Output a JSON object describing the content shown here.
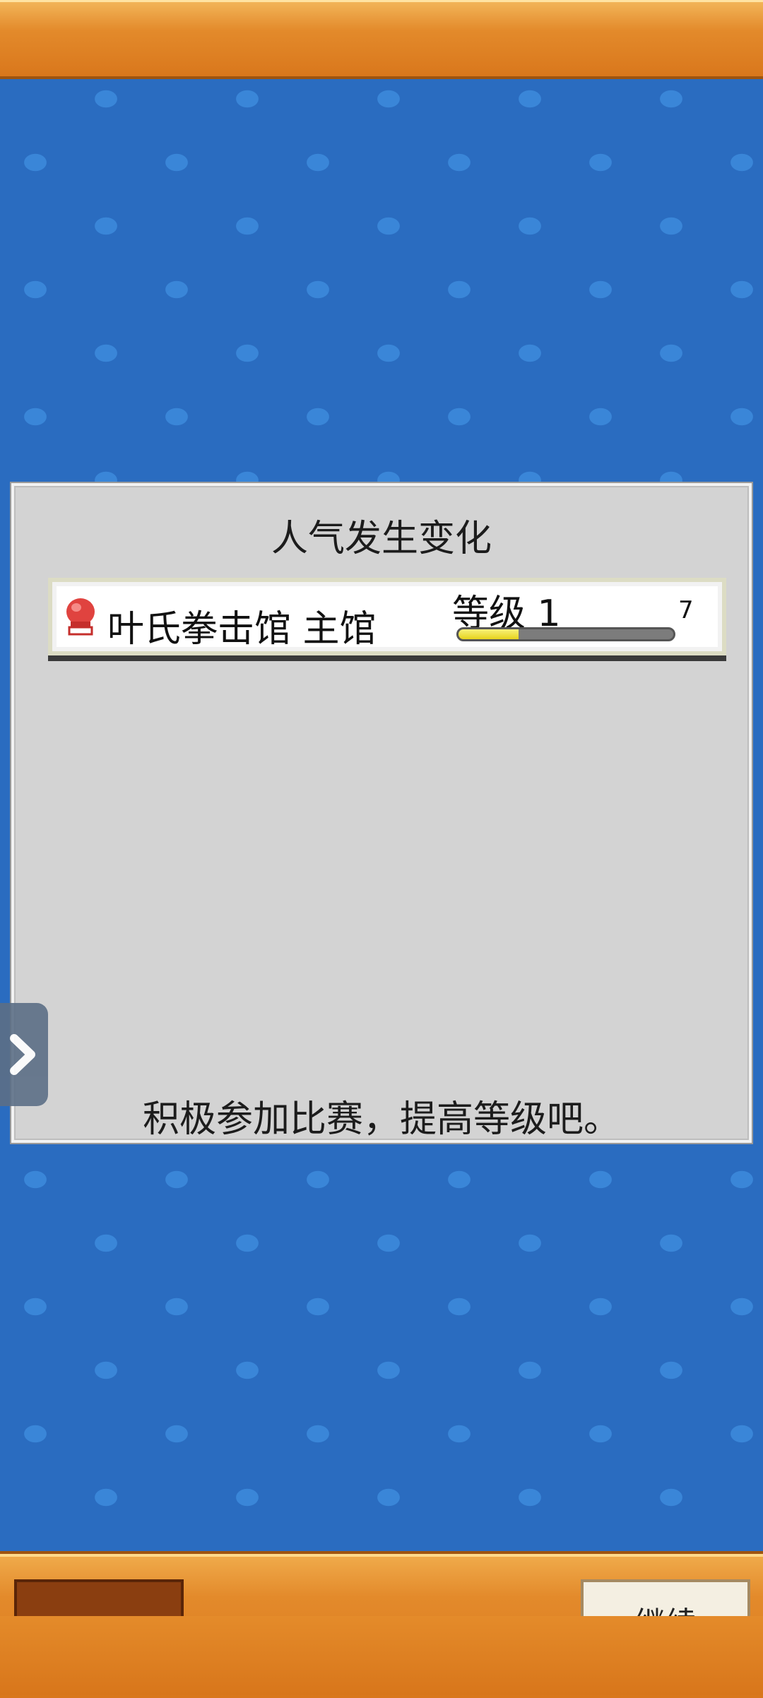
{
  "header": {},
  "dialog": {
    "title": "人气发生变化",
    "gym": {
      "name": "叶氏拳击馆 主馆",
      "level_label": "等级 1",
      "level_points": "7",
      "progress_fraction": 0.28,
      "icon": "boxing-glove-icon"
    },
    "hint": "积极参加比赛，提高等级吧。"
  },
  "side_tab": {
    "icon": "chevron-right-icon"
  },
  "footer": {
    "continue_label": "继续"
  },
  "colors": {
    "background": "#2a6cc0",
    "bar_orange": "#e38a2b",
    "panel": "#d3d3d3",
    "progress_yellow": "#e6d31c"
  }
}
